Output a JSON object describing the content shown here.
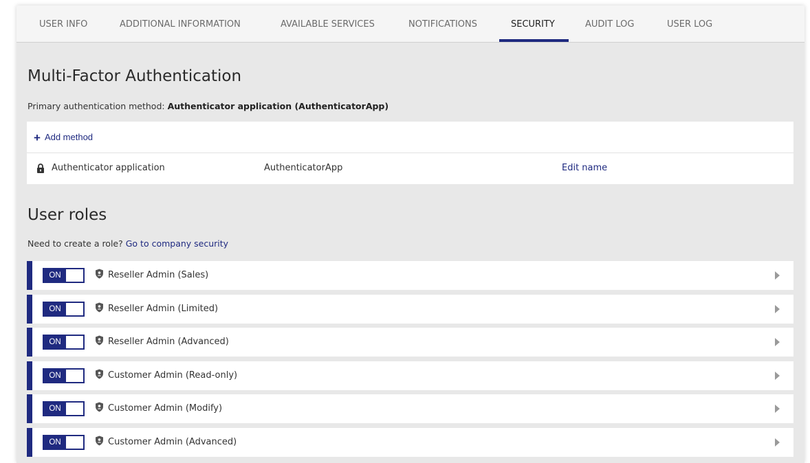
{
  "tabs": [
    {
      "label": "USER INFO"
    },
    {
      "label": "ADDITIONAL INFORMATION"
    },
    {
      "label": "AVAILABLE SERVICES"
    },
    {
      "label": "NOTIFICATIONS"
    },
    {
      "label": "SECURITY",
      "active": true
    },
    {
      "label": "AUDIT LOG"
    },
    {
      "label": "USER LOG"
    }
  ],
  "mfa": {
    "title": "Multi-Factor Authentication",
    "primary_prefix": "Primary authentication method:",
    "primary_value": "Authenticator application (AuthenticatorApp)",
    "add_method_label": "Add method",
    "method": {
      "icon": "lock-icon",
      "name": "Authenticator application",
      "type": "AuthenticatorApp",
      "edit_label": "Edit name"
    }
  },
  "roles": {
    "title": "User roles",
    "hint_text": "Need to create a role?",
    "hint_link": "Go to company security",
    "items": [
      {
        "toggle": "ON",
        "icon": "shield-icon",
        "name": "Reseller Admin (Sales)"
      },
      {
        "toggle": "ON",
        "icon": "shield-icon",
        "name": "Reseller Admin (Limited)"
      },
      {
        "toggle": "ON",
        "icon": "shield-icon",
        "name": "Reseller Admin (Advanced)"
      },
      {
        "toggle": "ON",
        "icon": "shield-icon",
        "name": "Customer Admin (Read-only)"
      },
      {
        "toggle": "ON",
        "icon": "shield-icon",
        "name": "Customer Admin (Modify)"
      },
      {
        "toggle": "ON",
        "icon": "shield-icon",
        "name": "Customer Admin (Advanced)"
      }
    ]
  },
  "colors": {
    "accent": "#1f2a80",
    "background": "#e8e8e8",
    "link": "#1f2a80"
  }
}
